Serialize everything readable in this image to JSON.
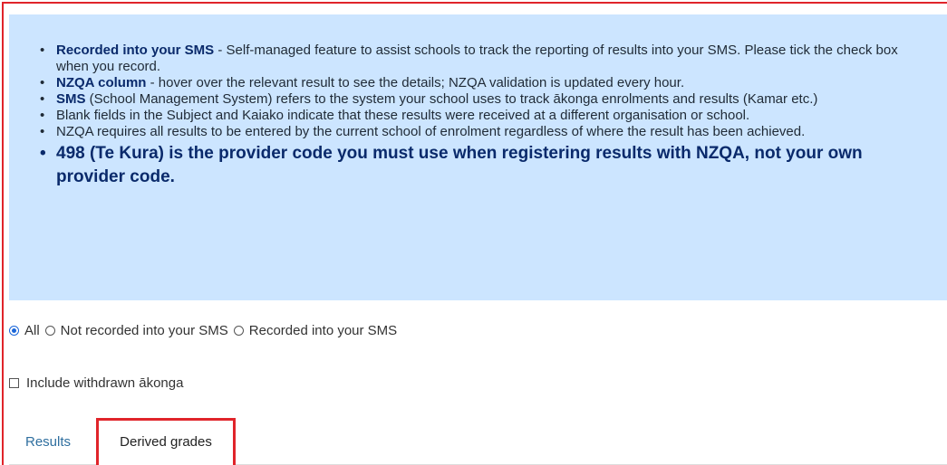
{
  "info": {
    "items": [
      {
        "bold": "Recorded into your SMS",
        "text": " - Self-managed feature to assist schools to track the reporting of results into your SMS. Please tick the check box when you record."
      },
      {
        "bold": "NZQA column",
        "text": " - hover over the relevant result to see the details; NZQA validation is updated every hour."
      },
      {
        "bold": "SMS",
        "text": " (School Management System) refers to the system your school uses to track ākonga enrolments and results (Kamar etc.)"
      },
      {
        "bold": "",
        "text": "Blank fields in the Subject and Kaiako indicate that these results were received at a different organisation or school."
      },
      {
        "bold": "",
        "text": "NZQA requires all results to be entered by the current school of enrolment regardless of where the result has been achieved."
      }
    ],
    "highlight": "498 (Te Kura) is the provider code you must use when registering results with NZQA, not your own provider code."
  },
  "filter": {
    "options": [
      "All",
      "Not recorded into your SMS",
      "Recorded into your SMS"
    ],
    "selected": "All"
  },
  "withdrawn": {
    "label": "Include withdrawn ākonga",
    "checked": false
  },
  "tabs": {
    "results": "Results",
    "derived": "Derived grades"
  },
  "colors": {
    "info_bg": "#cce5ff",
    "accent_red": "#e0242a",
    "link_blue": "#2f6f9f"
  }
}
